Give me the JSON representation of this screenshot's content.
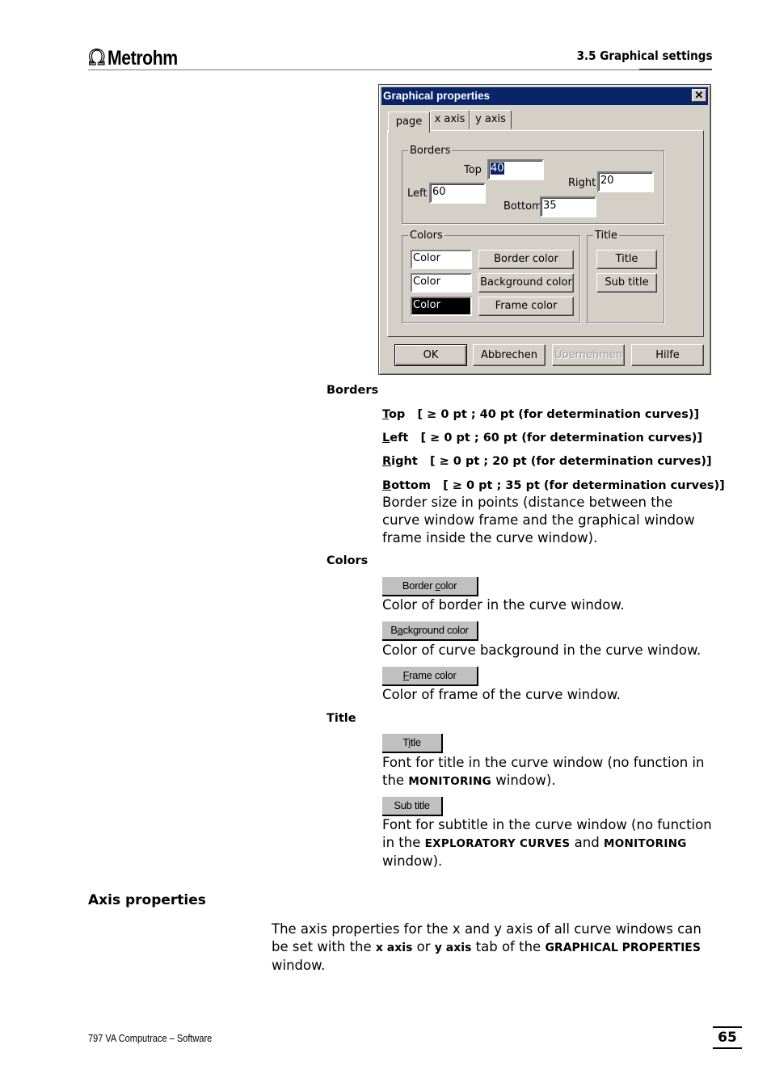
{
  "header": {
    "logo_text": "Metrohm",
    "logo_symbol": "Ω",
    "section": "3.5  Graphical settings"
  },
  "dialog": {
    "title": "Graphical properties",
    "close_symbol": "✕",
    "tabs": [
      {
        "label": "page",
        "active": true
      },
      {
        "label": "x axis",
        "active": false
      },
      {
        "label": "y axis",
        "active": false
      }
    ],
    "borders": {
      "group_label": "Borders",
      "top_label": "Top",
      "top_value": "40",
      "left_label": "Left",
      "left_value": "60",
      "right_label": "Right",
      "right_value": "20",
      "bottom_label": "Bottom",
      "bottom_value": "35"
    },
    "colors": {
      "group_label": "Colors",
      "rows": [
        {
          "swatch_text": "Color",
          "swatch_color": "#ffffff",
          "button": "Border color"
        },
        {
          "swatch_text": "Color",
          "swatch_color": "#ffffff",
          "button": "Background color"
        },
        {
          "swatch_text": "Color",
          "swatch_color": "#000000",
          "button": "Frame color"
        }
      ]
    },
    "title_group": {
      "group_label": "Title",
      "title_button": "Title",
      "subtitle_button": "Sub title"
    },
    "footer_buttons": {
      "ok": "OK",
      "cancel": "Abbrechen",
      "apply": "Übernehmen",
      "help": "Hilfe"
    }
  },
  "doc": {
    "borders_heading": "Borders",
    "params": [
      {
        "key_first": "T",
        "key_rest": "op",
        "range": "[ ≥ 0 pt ; 40 pt (for determination curves)]"
      },
      {
        "key_first": "L",
        "key_rest": "eft",
        "range": "[ ≥ 0 pt ; 60 pt (for determination curves)]"
      },
      {
        "key_first": "R",
        "key_rest": "ight",
        "range": "[ ≥ 0 pt ; 20 pt (for determination curves)]"
      },
      {
        "key_first": "B",
        "key_rest": "ottom",
        "range": "[ ≥ 0 pt ; 35 pt (for determination curves)]"
      }
    ],
    "borders_desc": "Border size in points (distance between the curve window frame and the graphical window frame inside the curve window).",
    "colors_heading": "Colors",
    "color_items": [
      {
        "button_pre": "Border ",
        "button_key": "c",
        "button_post": "olor",
        "desc": "Color of border in the curve window."
      },
      {
        "button_pre": "B",
        "button_key": "a",
        "button_post": "ckground color",
        "desc": "Color of curve background in the curve window."
      },
      {
        "button_pre": "",
        "button_key": "F",
        "button_post": "rame color",
        "desc": "Color of frame of the curve window."
      }
    ],
    "title_heading": "Title",
    "title_item": {
      "button_pre": "T",
      "button_key": "i",
      "button_post": "tle",
      "desc_pre": "Font for title in the curve window (no function in the ",
      "desc_bold": "MONITORING",
      "desc_post": " window)."
    },
    "subtitle_item": {
      "button": "Sub title",
      "desc_pre": "Font for subtitle in the curve window (no function in the ",
      "desc_bold1": "EXPLORATORY CURVES",
      "desc_mid": " and ",
      "desc_bold2": "MONITORING",
      "desc_post": " window)."
    },
    "axis_heading": "Axis properties",
    "axis_para": {
      "pre": "The axis properties for the x and y axis of all curve windows can be set with the ",
      "b1": "x axis",
      "mid1": " or ",
      "b2": "y axis",
      "mid2": " tab of the ",
      "b3": "GRAPHICAL PROPERTIES",
      "post": " window."
    }
  },
  "footer": {
    "product": "797 VA Computrace – Software",
    "page_number": "65"
  }
}
